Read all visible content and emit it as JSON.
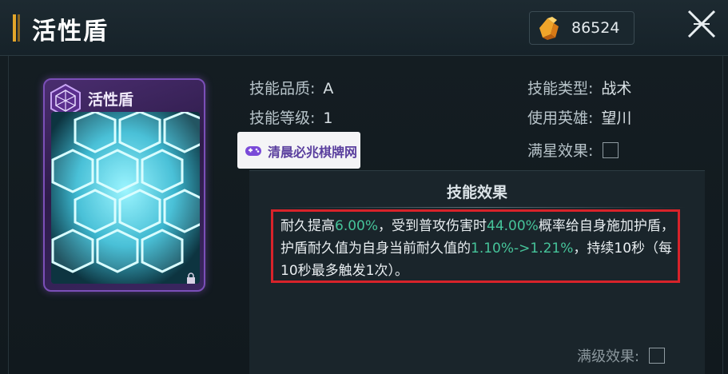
{
  "header": {
    "title": "活性盾",
    "currency_icon": "crystal-icon",
    "currency_value": "86524",
    "close_icon": "close-icon"
  },
  "card": {
    "name": "活性盾",
    "emblem_icon": "hexagon-emblem-icon",
    "accent_color": "#7b4fb8"
  },
  "attributes": {
    "quality_label": "技能品质:",
    "quality_value": "A",
    "level_label": "技能等级:",
    "level_value": "1",
    "type_label": "技能类型:",
    "type_value": "战术",
    "hero_label": "使用英雄:",
    "hero_value": "望川",
    "star_label": "满星效果:"
  },
  "watermark": {
    "text": "清晨必兆棋牌网"
  },
  "effect": {
    "title": "技能效果",
    "segments": [
      {
        "text": "耐久提高",
        "highlight": false
      },
      {
        "text": "6.00%",
        "highlight": true
      },
      {
        "text": "，受到普攻伤害时",
        "highlight": false
      },
      {
        "text": "44.00%",
        "highlight": true
      },
      {
        "text": "概率给自身施加护盾，护盾耐久值为自身当前耐久值的",
        "highlight": false
      },
      {
        "text": "1.10%->1.21%",
        "highlight": true
      },
      {
        "text": "，持续10秒（每10秒最多触发1次）。",
        "highlight": false
      }
    ],
    "highlight_color": "#46c49a",
    "box_color": "#d8232a",
    "max_level_label": "满级效果:"
  }
}
